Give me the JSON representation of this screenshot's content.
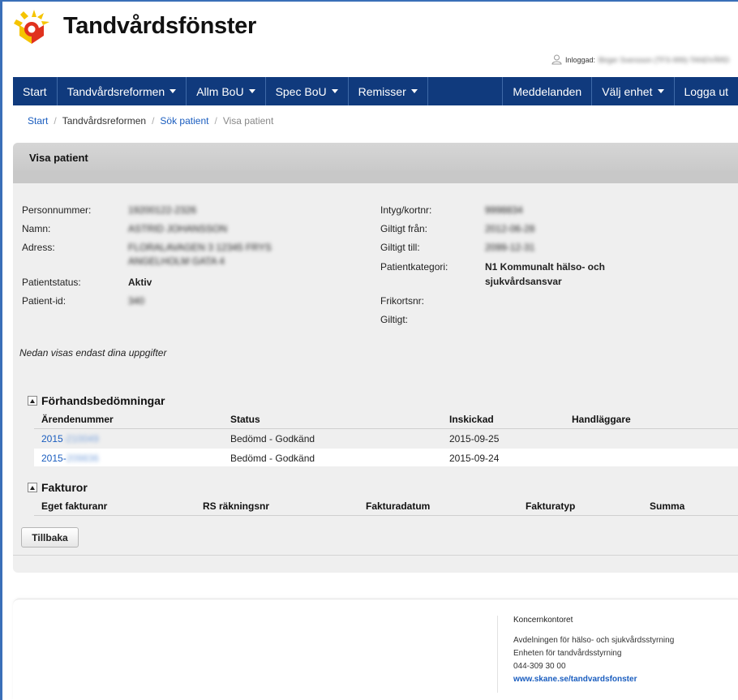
{
  "app": {
    "title": "Tandvårdsfönster"
  },
  "login": {
    "label": "Inloggad:",
    "user": "Birger Svensson (TFS-999)-TANDVÅRD"
  },
  "nav": {
    "start": "Start",
    "tandvardsreformen": "Tandvårdsreformen",
    "allm_bou": "Allm BoU",
    "spec_bou": "Spec BoU",
    "remisser": "Remisser",
    "meddelanden": "Meddelanden",
    "valj_enhet": "Välj enhet",
    "logga_ut": "Logga ut"
  },
  "breadcrumb": {
    "start": "Start",
    "sep": "/",
    "tandvardsreformen": "Tandvårdsreformen",
    "sok_patient": "Sök patient",
    "visa_patient": "Visa patient"
  },
  "panel": {
    "title": "Visa patient"
  },
  "patient": {
    "personnummer_label": "Personnummer:",
    "personnummer_value": "19200122-2326",
    "namn_label": "Namn:",
    "namn_value": "ASTRID JOHANSSON",
    "adress_label": "Adress:",
    "adress_line1": "FLORALAVAGEN 3 12345 FRYS",
    "adress_line2": "ANGELHOLM GATA 4",
    "patientstatus_label": "Patientstatus:",
    "patientstatus_value": "Aktiv",
    "patientid_label": "Patient-id:",
    "patientid_value": "340",
    "intyg_label": "Intyg/kortnr:",
    "intyg_value": "9998834",
    "giltigt_fran_label": "Giltigt från:",
    "giltigt_fran_value": "2012-06-28",
    "giltigt_till_label": "Giltigt till:",
    "giltigt_till_value": "2099-12-31",
    "patientkategori_label": "Patientkategori:",
    "patientkategori_line1": "N1 Kommunalt hälso- och",
    "patientkategori_line2": "sjukvårdsansvar",
    "frikortsnr_label": "Frikortsnr:",
    "giltigt_label": "Giltigt:"
  },
  "note": "Nedan visas endast dina uppgifter",
  "forhandsbedomningar": {
    "title": "Förhandsbedömningar",
    "headers": {
      "arendenummer": "Ärendenummer",
      "status": "Status",
      "inskickad": "Inskickad",
      "handlaggare": "Handläggare"
    },
    "rows": [
      {
        "arende_prefix": "2015",
        "arende_hidden": "-210049",
        "status": "Bedömd - Godkänd",
        "inskickad": "2015-09-25",
        "handlaggare": ""
      },
      {
        "arende_prefix": "2015-",
        "arende_hidden": "209836",
        "status": "Bedömd - Godkänd",
        "inskickad": "2015-09-24",
        "handlaggare": ""
      }
    ]
  },
  "fakturor": {
    "title": "Fakturor",
    "headers": {
      "eget": "Eget fakturanr",
      "rs": "RS räkningsnr",
      "datum": "Fakturadatum",
      "typ": "Fakturatyp",
      "summa": "Summa"
    }
  },
  "buttons": {
    "tillbaka": "Tillbaka"
  },
  "footer": {
    "org": "Koncernkontoret",
    "line1": "Avdelningen för hälso- och sjukvårdsstyrning",
    "line2": "Enheten för tandvårdsstyrning",
    "phone": "044-309 30 00",
    "url": "www.skane.se/tandvardsfonster"
  },
  "colors": {
    "nav_bg": "#103a7d",
    "link": "#1a5dbf",
    "panel_bg": "#efefef",
    "logo_yellow": "#f5c400",
    "logo_red": "#e0321e"
  }
}
